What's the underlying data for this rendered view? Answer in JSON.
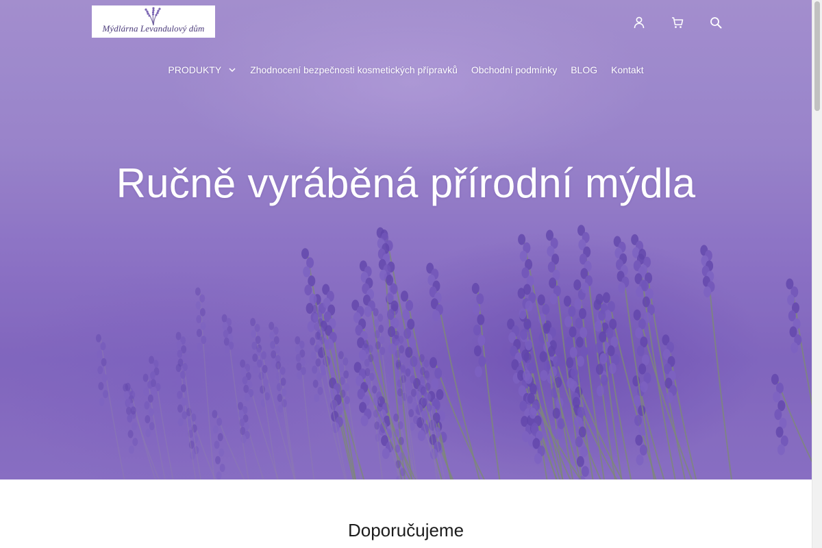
{
  "brand": {
    "logo_text": "Mýdlárna Levandulový dům"
  },
  "header_icons": [
    {
      "name": "user-icon"
    },
    {
      "name": "cart-icon"
    },
    {
      "name": "search-icon"
    }
  ],
  "nav": {
    "items": [
      {
        "label": "PRODUKTY",
        "has_dropdown": true
      },
      {
        "label": "Zhodnocení bezpečnosti kosmetických přípravků"
      },
      {
        "label": "Obchodní podmínky"
      },
      {
        "label": "BLOG"
      },
      {
        "label": "Kontakt"
      }
    ]
  },
  "hero": {
    "title": "Ručně vyráběná přírodní mýdla"
  },
  "recommended": {
    "title": "Doporučujeme"
  },
  "colors": {
    "hero_purple": "#8a70c4",
    "nav_text": "#ffffff",
    "logo_text": "#4a3a7a"
  }
}
